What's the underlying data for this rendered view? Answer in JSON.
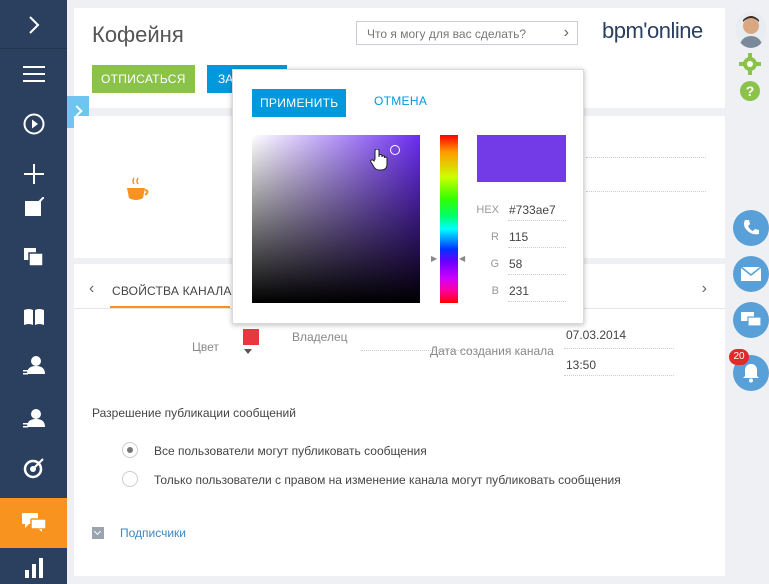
{
  "header": {
    "title": "Кофейня",
    "search_placeholder": "Что я могу для вас сделать?",
    "logo_text": "bpm'online",
    "unsubscribe_label": "ОТПИСАТЬСЯ",
    "second_button_label": "ЗА"
  },
  "tabs": {
    "active_label": "СВОЙСТВА КАНАЛА"
  },
  "fields": {
    "color_label": "Цвет",
    "color_value": "#e8373f",
    "owner_label": "Владелец",
    "date_created_label": "Дата создания канала",
    "date_value": "07.03.2014",
    "time_value": "13:50"
  },
  "permissions": {
    "heading": "Разрешение публикации сообщений",
    "options": [
      {
        "label": "Все пользователи могут публиковать сообщения",
        "checked": true
      },
      {
        "label": "Только пользователи с правом на изменение канала могут публиковать сообщения",
        "checked": false
      }
    ]
  },
  "subscribers": {
    "label": "Подписчики"
  },
  "color_picker": {
    "apply_label": "ПРИМЕНИТЬ",
    "cancel_label": "ОТМЕНА",
    "hex_label": "HEX",
    "hex_value": "#733ae7",
    "r_label": "R",
    "r_value": "115",
    "g_label": "G",
    "g_value": "58",
    "b_label": "B",
    "b_value": "231",
    "preview_color": "#733ae7"
  },
  "notifications": {
    "badge_count": "20"
  },
  "colors": {
    "nav_bg": "#2b3f5e",
    "accent_orange": "#f7931e",
    "accent_blue": "#0099dc",
    "accent_green": "#8bc34a"
  }
}
